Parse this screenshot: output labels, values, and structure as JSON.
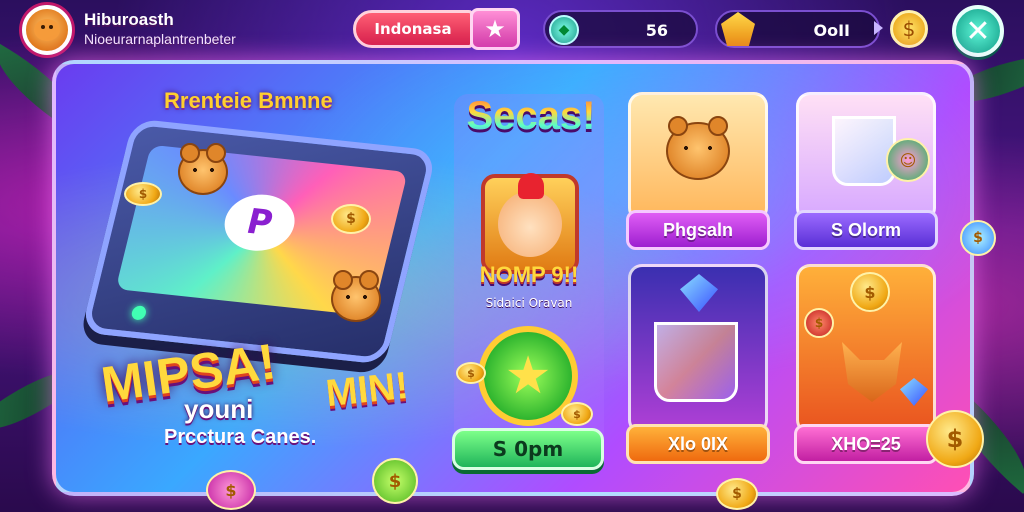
{
  "player": {
    "name": "Hiburoasth",
    "subtitle": "Nioeurarnaplantrenbeter"
  },
  "topbar": {
    "event_label": "Indonasa",
    "gems_value": "56",
    "gold_value": "OoΙI"
  },
  "promo": {
    "title": "Rrenteie Bmnne",
    "headline": "MIPSA!",
    "subline": "youni",
    "description": "Prcctura Canes.",
    "badge": "MIN!"
  },
  "featured": {
    "title": "Secas!",
    "name": "NOMP 9!!",
    "subtitle": "Sidaici Oravan",
    "button_label": "S 0pm"
  },
  "cards": [
    {
      "label": "Phgsaln"
    },
    {
      "label": "S Olorm"
    },
    {
      "label": "Xlo 0IX"
    },
    {
      "label": "XHO=25"
    }
  ],
  "colors": {
    "accent_purple": "#9d1fd0",
    "accent_green": "#1fb55a",
    "accent_gold": "#ffd93d",
    "close_teal": "#109c86"
  },
  "icons": {
    "star": "★",
    "close": "✕",
    "coin": "$",
    "gem": "◆"
  }
}
